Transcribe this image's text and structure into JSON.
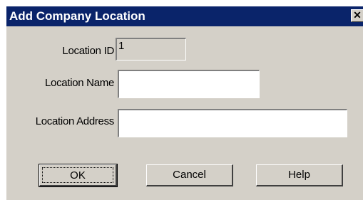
{
  "dialog": {
    "title": "Add Company Location",
    "close_icon": "✕"
  },
  "form": {
    "location_id": {
      "label": "Location ID",
      "value": "1"
    },
    "location_name": {
      "label": "Location Name",
      "value": ""
    },
    "location_address": {
      "label": "Location Address",
      "value": ""
    }
  },
  "buttons": {
    "ok": "OK",
    "cancel": "Cancel",
    "help": "Help"
  },
  "colors": {
    "titlebar": "#0a246a",
    "dialog_face": "#d4d0c8"
  }
}
